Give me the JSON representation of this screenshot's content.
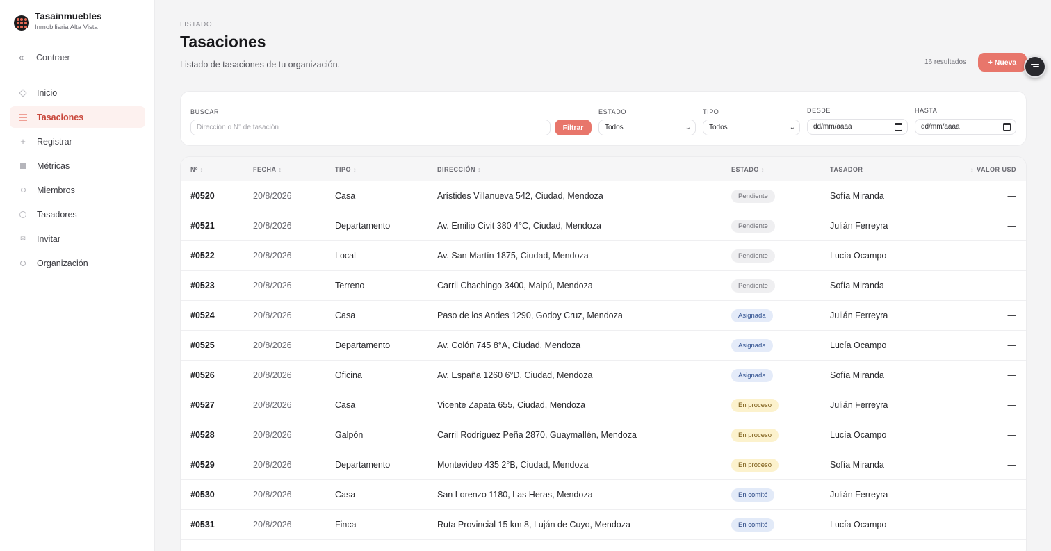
{
  "brand": {
    "name": "Tasainmuebles",
    "subtitle": "Inmobiliaria Alta Vista"
  },
  "sidebar": {
    "collapse_label": "Contraer",
    "items": [
      {
        "label": "Inicio",
        "icon": "home-icon"
      },
      {
        "label": "Tasaciones",
        "icon": "list-icon",
        "active": true
      },
      {
        "label": "Registrar",
        "icon": "plus-icon"
      },
      {
        "label": "Métricas",
        "icon": "chart-icon"
      },
      {
        "label": "Miembros",
        "icon": "members-icon"
      },
      {
        "label": "Tasadores",
        "icon": "appraisers-icon"
      },
      {
        "label": "Invitar",
        "icon": "mail-icon"
      },
      {
        "label": "Organización",
        "icon": "gear-icon"
      }
    ]
  },
  "header": {
    "eyebrow": "LISTADO",
    "title": "Tasaciones",
    "subtitle": "Listado de tasaciones de tu organización.",
    "results": "16 resultados",
    "new_button": "+ Nueva"
  },
  "filters": {
    "search_label": "BUSCAR",
    "search_placeholder": "Dirección o N° de tasación",
    "filter_button": "Filtrar",
    "estado_label": "ESTADO",
    "estado_value": "Todos",
    "tipo_label": "TIPO",
    "tipo_value": "Todos",
    "desde_label": "DESDE",
    "desde_value": "dd/mm/aaaa",
    "hasta_label": "HASTA",
    "hasta_value": "dd/mm/aaaa"
  },
  "table": {
    "headers": {
      "num": "Nº",
      "fecha": "FECHA",
      "tipo": "TIPO",
      "direccion": "DIRECCIÓN",
      "estado": "ESTADO",
      "tasador": "TASADOR",
      "valor": "VALOR USD",
      "sort_glyph": "↕"
    },
    "rows": [
      {
        "num": "#0520",
        "fecha": "20/8/2026",
        "tipo": "Casa",
        "direccion": "Arístides Villanueva 542, Ciudad, Mendoza",
        "estado": "Pendiente",
        "tasador": "Sofía Miranda",
        "valor": "—"
      },
      {
        "num": "#0521",
        "fecha": "20/8/2026",
        "tipo": "Departamento",
        "direccion": "Av. Emilio Civit 380 4°C, Ciudad, Mendoza",
        "estado": "Pendiente",
        "tasador": "Julián Ferreyra",
        "valor": "—"
      },
      {
        "num": "#0522",
        "fecha": "20/8/2026",
        "tipo": "Local",
        "direccion": "Av. San Martín 1875, Ciudad, Mendoza",
        "estado": "Pendiente",
        "tasador": "Lucía Ocampo",
        "valor": "—"
      },
      {
        "num": "#0523",
        "fecha": "20/8/2026",
        "tipo": "Terreno",
        "direccion": "Carril Chachingo 3400, Maipú, Mendoza",
        "estado": "Pendiente",
        "tasador": "Sofía Miranda",
        "valor": "—"
      },
      {
        "num": "#0524",
        "fecha": "20/8/2026",
        "tipo": "Casa",
        "direccion": "Paso de los Andes 1290, Godoy Cruz, Mendoza",
        "estado": "Asignada",
        "tasador": "Julián Ferreyra",
        "valor": "—"
      },
      {
        "num": "#0525",
        "fecha": "20/8/2026",
        "tipo": "Departamento",
        "direccion": "Av. Colón 745 8°A, Ciudad, Mendoza",
        "estado": "Asignada",
        "tasador": "Lucía Ocampo",
        "valor": "—"
      },
      {
        "num": "#0526",
        "fecha": "20/8/2026",
        "tipo": "Oficina",
        "direccion": "Av. España 1260 6°D, Ciudad, Mendoza",
        "estado": "Asignada",
        "tasador": "Sofía Miranda",
        "valor": "—"
      },
      {
        "num": "#0527",
        "fecha": "20/8/2026",
        "tipo": "Casa",
        "direccion": "Vicente Zapata 655, Ciudad, Mendoza",
        "estado": "En proceso",
        "tasador": "Julián Ferreyra",
        "valor": "—"
      },
      {
        "num": "#0528",
        "fecha": "20/8/2026",
        "tipo": "Galpón",
        "direccion": "Carril Rodríguez Peña 2870, Guaymallén, Mendoza",
        "estado": "En proceso",
        "tasador": "Lucía Ocampo",
        "valor": "—"
      },
      {
        "num": "#0529",
        "fecha": "20/8/2026",
        "tipo": "Departamento",
        "direccion": "Montevideo 435 2°B, Ciudad, Mendoza",
        "estado": "En proceso",
        "tasador": "Sofía Miranda",
        "valor": "—"
      },
      {
        "num": "#0530",
        "fecha": "20/8/2026",
        "tipo": "Casa",
        "direccion": "San Lorenzo 1180, Las Heras, Mendoza",
        "estado": "En comité",
        "tasador": "Julián Ferreyra",
        "valor": "—"
      },
      {
        "num": "#0531",
        "fecha": "20/8/2026",
        "tipo": "Finca",
        "direccion": "Ruta Provincial 15 km 8, Luján de Cuyo, Mendoza",
        "estado": "En comité",
        "tasador": "Lucía Ocampo",
        "valor": "—"
      }
    ]
  },
  "colors": {
    "accent": "#e8766b",
    "active_text": "#c9483c",
    "active_bg": "#fdf1ef"
  }
}
